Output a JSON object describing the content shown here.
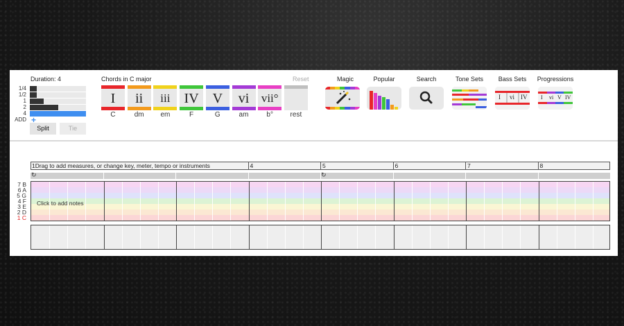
{
  "duration": {
    "title": "Duration: 4",
    "rows": [
      {
        "label": "1/4",
        "fill": 0.12
      },
      {
        "label": "1/2",
        "fill": 0.12
      },
      {
        "label": "1",
        "fill": 0.25
      },
      {
        "label": "2",
        "fill": 0.5
      },
      {
        "label": "4",
        "fill": 1.0
      },
      {
        "label": "ADD",
        "fill": 0
      }
    ],
    "selected_index": 4,
    "split_label": "Split",
    "tie_label": "Tie"
  },
  "chords": {
    "title": "Chords in C major",
    "reset_label": "Reset",
    "items": [
      {
        "numeral": "I",
        "name": "C",
        "color": "#e8262a"
      },
      {
        "numeral": "ii",
        "name": "dm",
        "color": "#f39a1c"
      },
      {
        "numeral": "iii",
        "name": "em",
        "color": "#f0d21c"
      },
      {
        "numeral": "IV",
        "name": "F",
        "color": "#3fc63a"
      },
      {
        "numeral": "V",
        "name": "G",
        "color": "#3b5fe0"
      },
      {
        "numeral": "vi",
        "name": "am",
        "color": "#a43ad6"
      },
      {
        "numeral": "vii°",
        "name": "b°",
        "color": "#e83fc4"
      },
      {
        "numeral": "",
        "name": "rest",
        "color": "#bfbfbf"
      }
    ]
  },
  "tools": [
    {
      "label": "Magic",
      "icon": "magic-wand-icon"
    },
    {
      "label": "Popular",
      "icon": "bar-chart-icon"
    },
    {
      "label": "Search",
      "icon": "search-icon"
    },
    {
      "label": "Tone Sets",
      "icon": "tone-sets-icon"
    },
    {
      "label": "Bass Sets",
      "icon": "bass-sets-icon"
    },
    {
      "label": "Progressions",
      "icon": "progressions-icon"
    }
  ],
  "bass_preview": [
    "I",
    "vi",
    "IV"
  ],
  "prog_preview": [
    "I",
    "vi",
    "V",
    "IV"
  ],
  "sequencer": {
    "measures": [
      {
        "num": "1",
        "text": "Drag to add measures, or change key, meter, tempo or instruments"
      },
      {
        "num": "4",
        "text": ""
      },
      {
        "num": "5",
        "text": ""
      },
      {
        "num": "6",
        "text": ""
      },
      {
        "num": "7",
        "text": ""
      },
      {
        "num": "8",
        "text": ""
      }
    ],
    "loop_icon": "loop-icon",
    "notes": [
      {
        "label": "7 B",
        "color": "#f7d6f3"
      },
      {
        "label": "6 A",
        "color": "#ecd9f7"
      },
      {
        "label": "5 G",
        "color": "#dfe2fb"
      },
      {
        "label": "4 F",
        "color": "#dcf3d4"
      },
      {
        "label": "3 E",
        "color": "#faf6d4"
      },
      {
        "label": "2 D",
        "color": "#fbe8d3"
      },
      {
        "label": "1 C",
        "color": "#fbd6d6"
      }
    ],
    "click_hint": "Click to add notes",
    "accent_color": "#e02020"
  }
}
